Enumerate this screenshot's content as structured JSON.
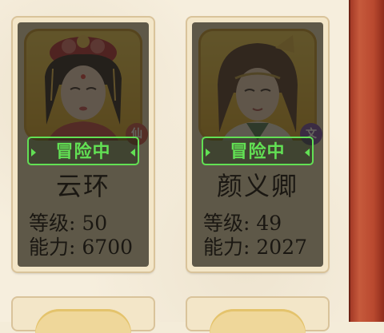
{
  "status_label": "冒险中",
  "cards": [
    {
      "name": "云环",
      "level_label": "等级:",
      "level": "50",
      "power_label": "能力:",
      "power": "6700",
      "tag_icon": "red-role-badge",
      "tag_color": "#c9443a"
    },
    {
      "name": "颜义卿",
      "level_label": "等级:",
      "level": "49",
      "power_label": "能力:",
      "power": "2027",
      "tag_icon": "purple-role-badge",
      "tag_color": "#6b3fa0"
    }
  ],
  "colors": {
    "status_green": "#62e054",
    "side_frame": "#b9492f",
    "background": "#f4ecd9"
  }
}
